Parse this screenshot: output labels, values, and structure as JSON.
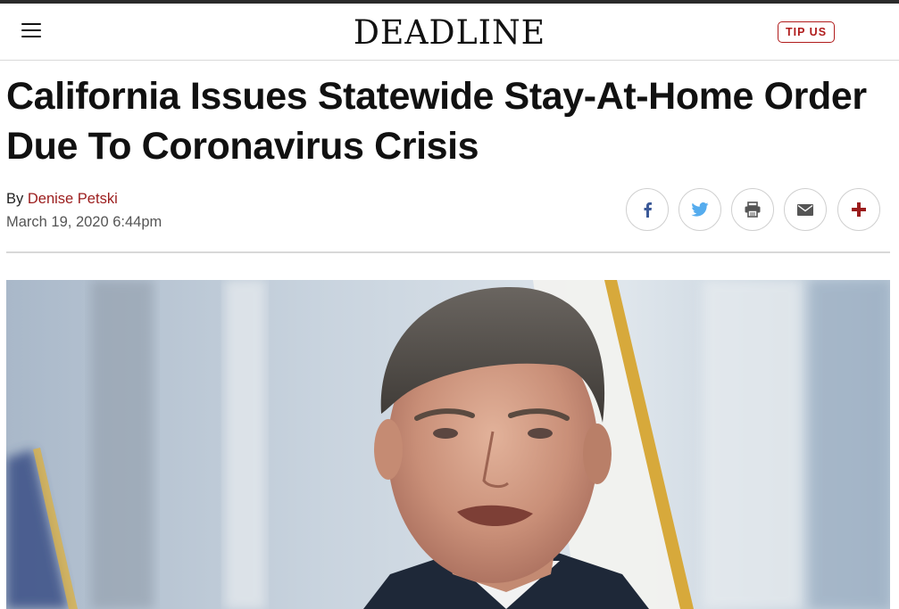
{
  "header": {
    "logo": "DEADLINE",
    "tip_label": "TIP US"
  },
  "article": {
    "title": "California Issues Statewide Stay-At-Home Order Due To Coronavirus Crisis",
    "byline_prefix": "By",
    "author": "Denise Petski",
    "date": "March 19, 2020 6:44pm"
  },
  "share": [
    {
      "icon": "facebook-icon"
    },
    {
      "icon": "twitter-icon"
    },
    {
      "icon": "print-icon"
    },
    {
      "icon": "email-icon"
    },
    {
      "icon": "more-share-icon"
    }
  ],
  "colors": {
    "accent": "#b01c1c",
    "author": "#9b1c1c",
    "facebook": "#3b5998",
    "twitter": "#55acee"
  }
}
